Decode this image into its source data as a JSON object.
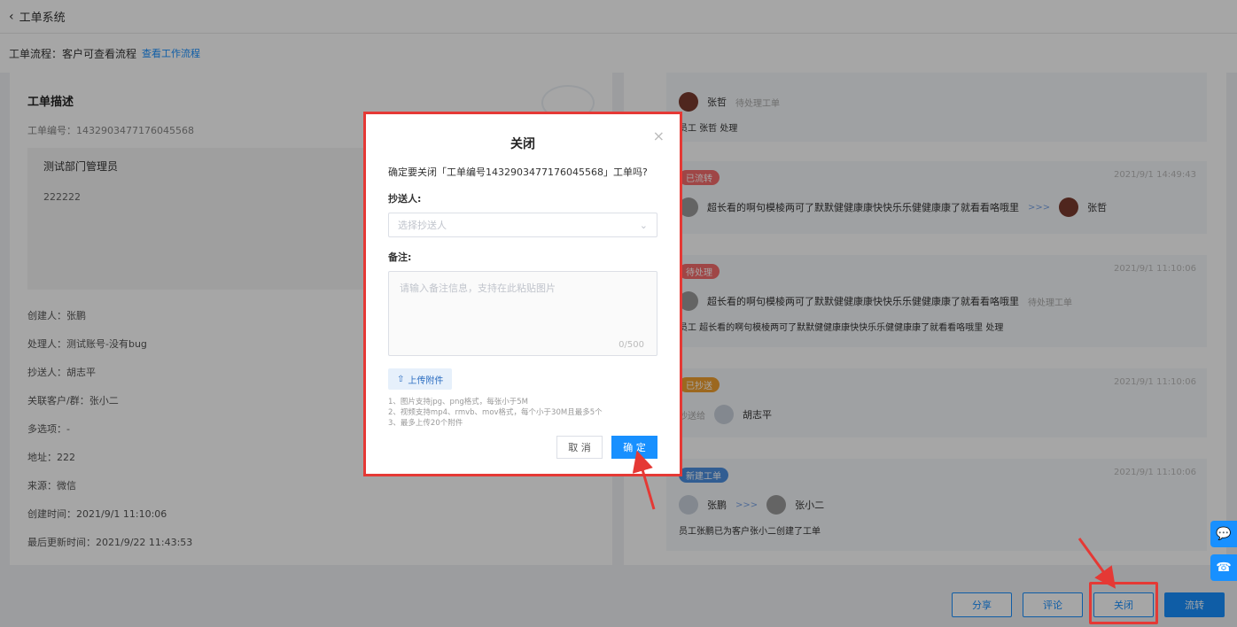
{
  "header": {
    "back_icon": "chevron-left-icon",
    "title": "工单系统"
  },
  "flow": {
    "label": "工单流程：客户可查看流程",
    "link": "查看工作流程"
  },
  "left": {
    "title": "工单描述",
    "order_no": "工单编号：1432903477176045568",
    "desc_author": "测试部门管理员",
    "desc_text": "222222",
    "fields": [
      "创建人：张鹏",
      "处理人：测试账号-没有bug",
      "抄送人：胡志平",
      "关联客户/群：张小二",
      "多选项：-",
      "地址：222",
      "来源：微信",
      "创建时间：2021/9/1 11:10:06",
      "最后更新时间：2021/9/22 11:43:53"
    ]
  },
  "timeline": {
    "item1": {
      "name": "张哲",
      "status": "待处理工单",
      "text": "员工 张哲 处理"
    },
    "item2": {
      "tag": "已流转",
      "time": "2021/9/1 14:49:43",
      "from": "超长看的啊句模棱两可了默默健健康康快快乐乐健健康康了就看看咯哦里",
      "arrow": ">>>",
      "to": "张哲"
    },
    "item3": {
      "tag": "待处理",
      "time": "2021/9/1 11:10:06",
      "name": "超长看的啊句模棱两可了默默健健康康快快乐乐健健康康了就看看咯哦里",
      "status": "待处理工单",
      "text": "员工 超长看的啊句模棱两可了默默健健康康快快乐乐健健康康了就看看咯哦里 处理"
    },
    "item4": {
      "tag": "已抄送",
      "time": "2021/9/1 11:10:06",
      "prefix": "抄送给",
      "name": "胡志平"
    },
    "item5": {
      "tag": "新建工单",
      "time": "2021/9/1 11:10:06",
      "from": "张鹏",
      "arrow": ">>>",
      "to": "张小二",
      "text": "员工张鹏已为客户张小二创建了工单"
    }
  },
  "bottom": {
    "share": "分享",
    "comment": "评论",
    "close": "关闭",
    "transfer": "流转"
  },
  "modal": {
    "title": "关闭",
    "close_icon": "×",
    "confirm": "确定要关闭「工单编号1432903477176045568」工单吗?",
    "cc_label": "抄送人:",
    "cc_placeholder": "选择抄送人",
    "note_label": "备注:",
    "note_placeholder": "请输入备注信息，支持在此粘贴图片",
    "note_counter": "0/500",
    "upload_label": "上传附件",
    "hint1": "1、图片支持jpg、png格式，每张小于5M",
    "hint2": "2、视频支持mp4、rmvb、mov格式，每个小于30M且最多5个",
    "hint3": "3、最多上传20个附件",
    "cancel": "取 消",
    "ok": "确 定"
  },
  "colors": {
    "primary": "#1890ff",
    "highlight": "#e53935"
  }
}
